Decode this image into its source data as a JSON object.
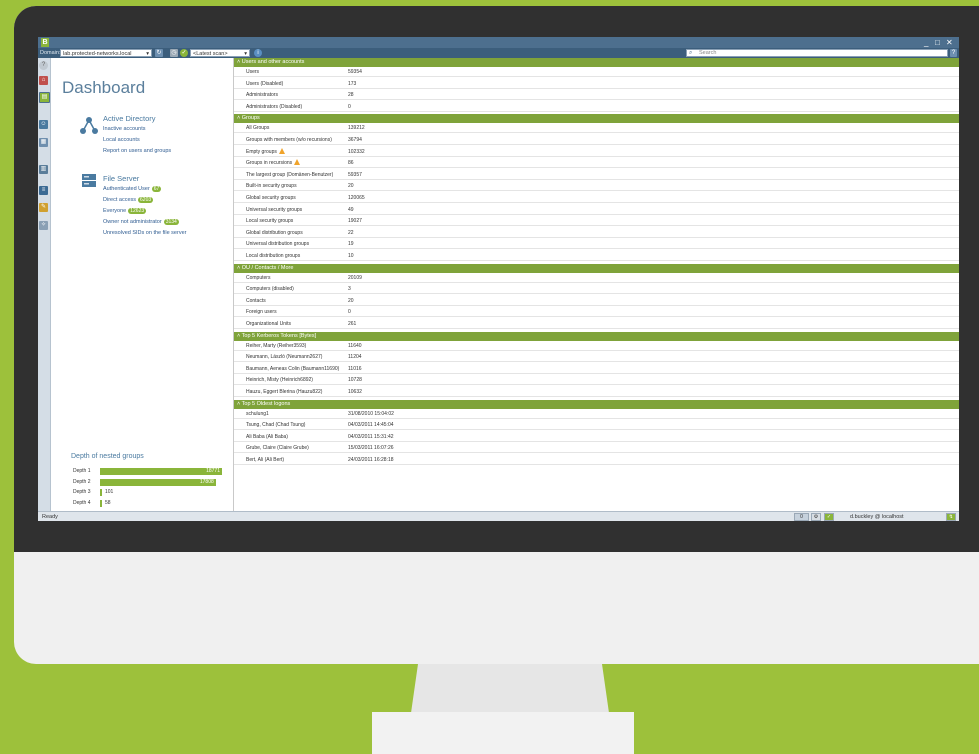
{
  "app": {
    "logo": "B"
  },
  "window_controls": [
    "_",
    "□",
    "✕"
  ],
  "toolbar": {
    "domain_label": "Domain:",
    "domain_value": "lab.protected-networks.local",
    "scan_value": "<Latest scan>",
    "search_placeholder": "Search"
  },
  "dashboard": {
    "title": "Dashboard",
    "active_directory": {
      "title": "Active Directory",
      "links": [
        "Inactive accounts",
        "Local accounts",
        "Report on users and groups"
      ]
    },
    "file_server": {
      "title": "File Server",
      "links": [
        {
          "label": "Authenticated User",
          "badge": "67"
        },
        {
          "label": "Direct access",
          "badge": "6203"
        },
        {
          "label": "Everyone",
          "badge": "12623"
        },
        {
          "label": "Owner not administrator",
          "badge": "3134"
        },
        {
          "label": "Unresolved SIDs on the file server",
          "badge": ""
        }
      ]
    },
    "depth": {
      "title": "Depth of nested groups",
      "rows": [
        {
          "label": "Depth 1",
          "value": "18771",
          "fraction": 1.0
        },
        {
          "label": "Depth 2",
          "value": "17808",
          "fraction": 0.949
        },
        {
          "label": "Depth 3",
          "value": "101",
          "fraction": 0.005
        },
        {
          "label": "Depth 4",
          "value": "58",
          "fraction": 0.003
        }
      ]
    }
  },
  "sections": {
    "users": {
      "title": "Users and other accounts",
      "rows": [
        {
          "k": "Users",
          "v": "59354"
        },
        {
          "k": "Users (Disabled)",
          "v": "173"
        },
        {
          "k": "Administrators",
          "v": "28"
        },
        {
          "k": "Administrators (Disabled)",
          "v": "0"
        }
      ]
    },
    "groups": {
      "title": "Groups",
      "rows": [
        {
          "k": "All Groups",
          "v": "139212"
        },
        {
          "k": "Groups with members (w/o recursions)",
          "v": "36794"
        },
        {
          "k": "Empty groups",
          "v": "102332"
        },
        {
          "k": "Groups in recursions",
          "v": "86"
        },
        {
          "k": "The largest group (Domänen-Benutzer)",
          "v": "59357"
        },
        {
          "k": "Built-in security groups",
          "v": "20"
        },
        {
          "k": "Global security groups",
          "v": "120065"
        },
        {
          "k": "Universal security groups",
          "v": "49"
        },
        {
          "k": "Local security groups",
          "v": "19027"
        },
        {
          "k": "Global distribution groups",
          "v": "22"
        },
        {
          "k": "Universal distribution groups",
          "v": "19"
        },
        {
          "k": "Local distribution groups",
          "v": "10"
        }
      ]
    },
    "ou": {
      "title": "OU / Contacts / More",
      "rows": [
        {
          "k": "Computers",
          "v": "20109"
        },
        {
          "k": "Computers (disabled)",
          "v": "3"
        },
        {
          "k": "Contacts",
          "v": "20"
        },
        {
          "k": "Foreign users",
          "v": "0"
        },
        {
          "k": "Organizational Units",
          "v": "261"
        }
      ]
    },
    "kerberos": {
      "title": "Top 5 Kerberos Tokens [Bytes]",
      "rows": [
        {
          "k": "Reiher, Marty (Reiher3593)",
          "v": "11640"
        },
        {
          "k": "Neumann, László (Neumann2627)",
          "v": "11204"
        },
        {
          "k": "Baumann, Aeneas Colin (Baumann11690)",
          "v": "11016"
        },
        {
          "k": "Heinrich, Misty (Heinrich6892)",
          "v": "10728"
        },
        {
          "k": "Hauzu, Eggert Blerina (Hauzu822)",
          "v": "10632"
        }
      ]
    },
    "logons": {
      "title": "Top 5 Oldest logons",
      "rows": [
        {
          "k": "schulung1",
          "v": "31/08/2010 15:04:02"
        },
        {
          "k": "Tsung, Chad (Chad Tsung)",
          "v": "04/03/2011 14:45:04"
        },
        {
          "k": "Ali Baba (Ali Baba)",
          "v": "04/03/2011 15:31:42"
        },
        {
          "k": "Grube, Claire (Claire Grube)",
          "v": "15/03/2011 16:07:26"
        },
        {
          "k": "Bert, Ali (Ali Bert)",
          "v": "24/03/2011 16:28:18"
        }
      ]
    }
  },
  "statusbar": {
    "status": "Ready",
    "count": "0",
    "user": "d.buckley @ localhost"
  },
  "colors": {
    "accent_green": "#8ab53a",
    "header_blue": "#4d6f8e",
    "background": "#9dc13b"
  }
}
